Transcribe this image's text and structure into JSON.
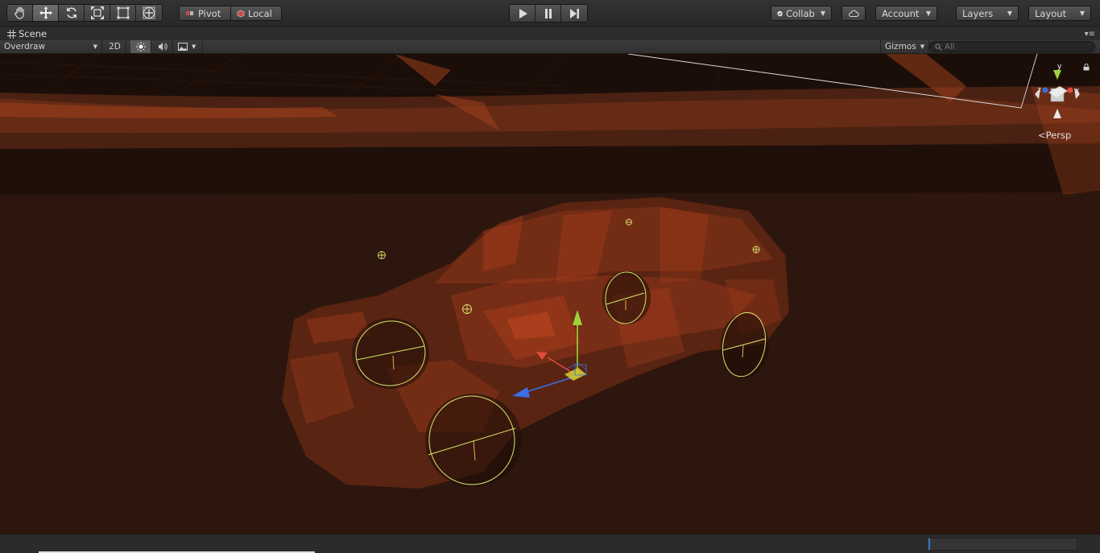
{
  "toolbar": {
    "tools": [
      {
        "name": "hand-tool",
        "icon": "hand-icon",
        "active": false
      },
      {
        "name": "move-tool",
        "icon": "move-icon",
        "active": true
      },
      {
        "name": "rotate-tool",
        "icon": "rotate-icon",
        "active": false
      },
      {
        "name": "scale-tool",
        "icon": "scale-icon",
        "active": false
      },
      {
        "name": "rect-tool",
        "icon": "rect-icon",
        "active": false
      },
      {
        "name": "transform-tool",
        "icon": "transform-icon",
        "active": false
      }
    ],
    "pivot_label": "Pivot",
    "local_label": "Local",
    "collab_label": "Collab",
    "account_label": "Account",
    "layers_label": "Layers",
    "layout_label": "Layout"
  },
  "scene": {
    "tab_label": "Scene",
    "draw_mode": "Overdraw",
    "mode_2d_label": "2D",
    "gizmos_label": "Gizmos",
    "search_placeholder": "All",
    "projection_label": "Persp"
  },
  "colors": {
    "overdraw": "#c2461f",
    "wheel_collider": "#d6e86a",
    "axis_x": "#e24a3a",
    "axis_y": "#9ad43a",
    "axis_z": "#3a6ee2",
    "progress_accent": "#3b7bbf"
  }
}
